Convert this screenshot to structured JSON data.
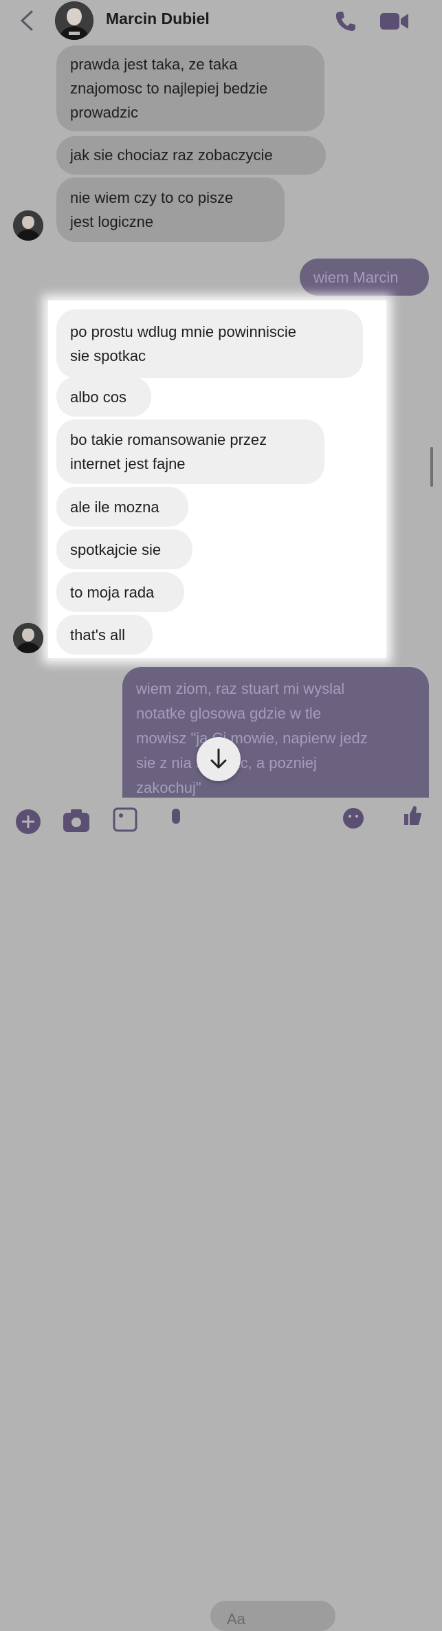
{
  "header": {
    "contact_name": "Marcin Dubiel",
    "accent_color": "#5b5073"
  },
  "messages": [
    {
      "sender": "Marcin Dubiel",
      "lines": [
        "prawda jest taka, ze taka",
        "znajomosc to najlepiej bedzie",
        "prowadzic"
      ]
    },
    {
      "sender": "Marcin Dubiel",
      "lines": [
        "jak sie chociaz raz zobaczycie"
      ]
    },
    {
      "sender": "Marcin Dubiel",
      "lines": [
        "nie wiem czy to co pisze",
        "jest logiczne"
      ]
    },
    {
      "sender": "me",
      "lines": [
        "wiem Marcin"
      ]
    },
    {
      "sender": "Marcin Dubiel",
      "lines": [
        "po prostu wdlug mnie powinniscie",
        "sie spotkac"
      ]
    },
    {
      "sender": "Marcin Dubiel",
      "lines": [
        "albo cos"
      ]
    },
    {
      "sender": "Marcin Dubiel",
      "lines": [
        "bo takie romansowanie przez",
        "internet jest fajne"
      ]
    },
    {
      "sender": "Marcin Dubiel",
      "lines": [
        "ale ile mozna"
      ]
    },
    {
      "sender": "Marcin Dubiel",
      "lines": [
        "spotkajcie sie"
      ]
    },
    {
      "sender": "Marcin Dubiel",
      "lines": [
        "to moja rada"
      ]
    },
    {
      "sender": "Marcin Dubiel",
      "lines": [
        "that's all"
      ]
    },
    {
      "sender": "me",
      "lines": [
        "wiem ziom, raz stuart mi wyslal",
        "notatke glosowa gdzie w tle",
        "mowisz \"ja Ci mowie, napierw jedz",
        "sie z nia spotkac, a pozniej",
        "zakochuj\""
      ]
    }
  ],
  "composer": {
    "placeholder": "Aa"
  }
}
